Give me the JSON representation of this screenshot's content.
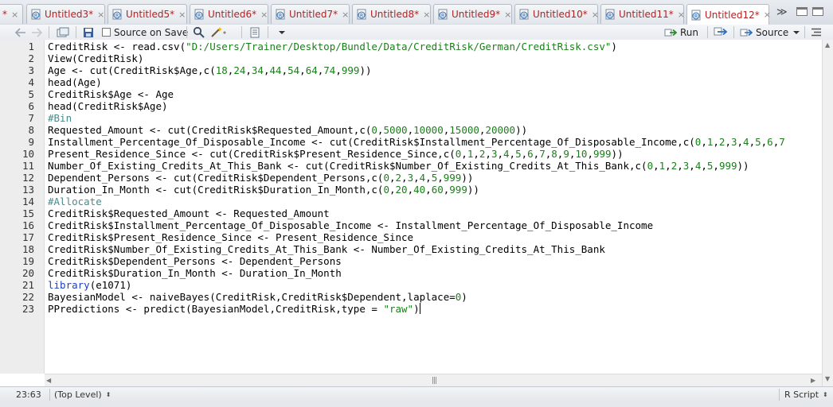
{
  "tabs": [
    {
      "label": "*",
      "closable": false
    },
    {
      "label": "Untitled3*"
    },
    {
      "label": "Untitled5*"
    },
    {
      "label": "Untitled6*"
    },
    {
      "label": "Untitled7*"
    },
    {
      "label": "Untitled8*"
    },
    {
      "label": "Untitled9*"
    },
    {
      "label": "Untitled10*"
    },
    {
      "label": "Untitled11*"
    },
    {
      "label": "Untitled12*",
      "active": true
    }
  ],
  "tab_close_glyph": "×",
  "tab_overflow_glyph": "≫",
  "toolbar": {
    "source_on_save_label": "Source on Save",
    "run_label": "Run",
    "source_label": "Source"
  },
  "editor": {
    "line_numbers": [
      "1",
      "2",
      "3",
      "4",
      "5",
      "6",
      "7",
      "8",
      "9",
      "10",
      "11",
      "12",
      "13",
      "14",
      "15",
      "16",
      "17",
      "18",
      "19",
      "20",
      "21",
      "22",
      "23"
    ],
    "lines": [
      "CreditRisk <- read.csv(\"D:/Users/Trainer/Desktop/Bundle/Data/CreditRisk/German/CreditRisk.csv\")",
      "View(CreditRisk)",
      "Age <- cut(CreditRisk$Age,c(18,24,34,44,54,64,74,999))",
      "head(Age)",
      "CreditRisk$Age <- Age",
      "head(CreditRisk$Age)",
      "#Bin",
      "Requested_Amount <- cut(CreditRisk$Requested_Amount,c(0,5000,10000,15000,20000))",
      "Installment_Percentage_Of_Disposable_Income <- cut(CreditRisk$Installment_Percentage_Of_Disposable_Income,c(0,1,2,3,4,5,6,7",
      "Present_Residence_Since <- cut(CreditRisk$Present_Residence_Since,c(0,1,2,3,4,5,6,7,8,9,10,999))",
      "Number_Of_Existing_Credits_At_This_Bank <- cut(CreditRisk$Number_Of_Existing_Credits_At_This_Bank,c(0,1,2,3,4,5,999))",
      "Dependent_Persons <- cut(CreditRisk$Dependent_Persons,c(0,2,3,4,5,999))",
      "Duration_In_Month <- cut(CreditRisk$Duration_In_Month,c(0,20,40,60,999))",
      "#Allocate",
      "CreditRisk$Requested_Amount <- Requested_Amount",
      "CreditRisk$Installment_Percentage_Of_Disposable_Income <- Installment_Percentage_Of_Disposable_Income",
      "CreditRisk$Present_Residence_Since <- Present_Residence_Since",
      "CreditRisk$Number_Of_Existing_Credits_At_This_Bank <- Number_Of_Existing_Credits_At_This_Bank",
      "CreditRisk$Dependent_Persons <- Dependent_Persons",
      "CreditRisk$Duration_In_Month <- Duration_In_Month",
      "library(e1071)",
      "BayesianModel <- naiveBayes(CreditRisk,CreditRisk$Dependent,laplace=0)",
      "PPredictions <- predict(BayesianModel,CreditRisk,type = \"raw\")"
    ]
  },
  "status": {
    "cursor_position": "23:63",
    "scope": "(Top Level)",
    "file_type": "R Script"
  },
  "colors": {
    "tab_text": "#b22222",
    "keyword": "#1e3fbf",
    "string": "#1a7f1a",
    "comment": "#4a8a8a"
  }
}
